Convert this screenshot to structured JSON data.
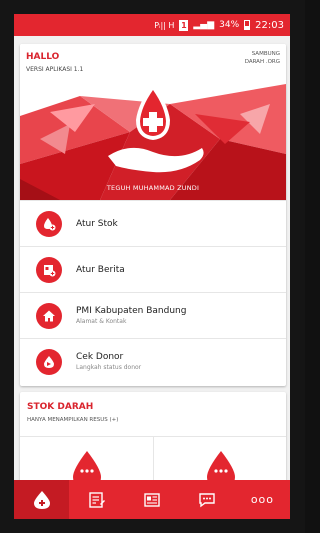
{
  "status_bar": {
    "signal_text": "Pᵢ|| H",
    "sim": "1",
    "battery": "34%",
    "time": "22:03"
  },
  "header": {
    "greeting": "HALLO",
    "version": "VERSI APLIKASI 1.1",
    "brand": "SAMBUNG DARAH .ORG",
    "user_name": "TEGUH MUHAMMAD ZUNDI"
  },
  "menu": {
    "items": [
      {
        "title": "Atur Stok",
        "subtitle": "",
        "icon": "blood-drop-add-icon"
      },
      {
        "title": "Atur Berita",
        "subtitle": "",
        "icon": "news-add-icon"
      },
      {
        "title": "PMI Kabupaten Bandung",
        "subtitle": "Alamat & Kontak",
        "icon": "home-icon"
      },
      {
        "title": "Cek Donor",
        "subtitle": "Langkah status donor",
        "icon": "arrow-drop-icon"
      }
    ]
  },
  "stok": {
    "title": "STOK DARAH",
    "subtitle": "HANYA MENAMPILKAN RESUS (+)"
  },
  "bottom_nav": {
    "tabs": [
      "blood-icon",
      "edit-note-icon",
      "newspaper-icon",
      "chat-icon",
      "more-icon"
    ],
    "more_label": "ooo"
  },
  "colors": {
    "primary": "#e3262f",
    "primary_dark": "#c41b23"
  }
}
